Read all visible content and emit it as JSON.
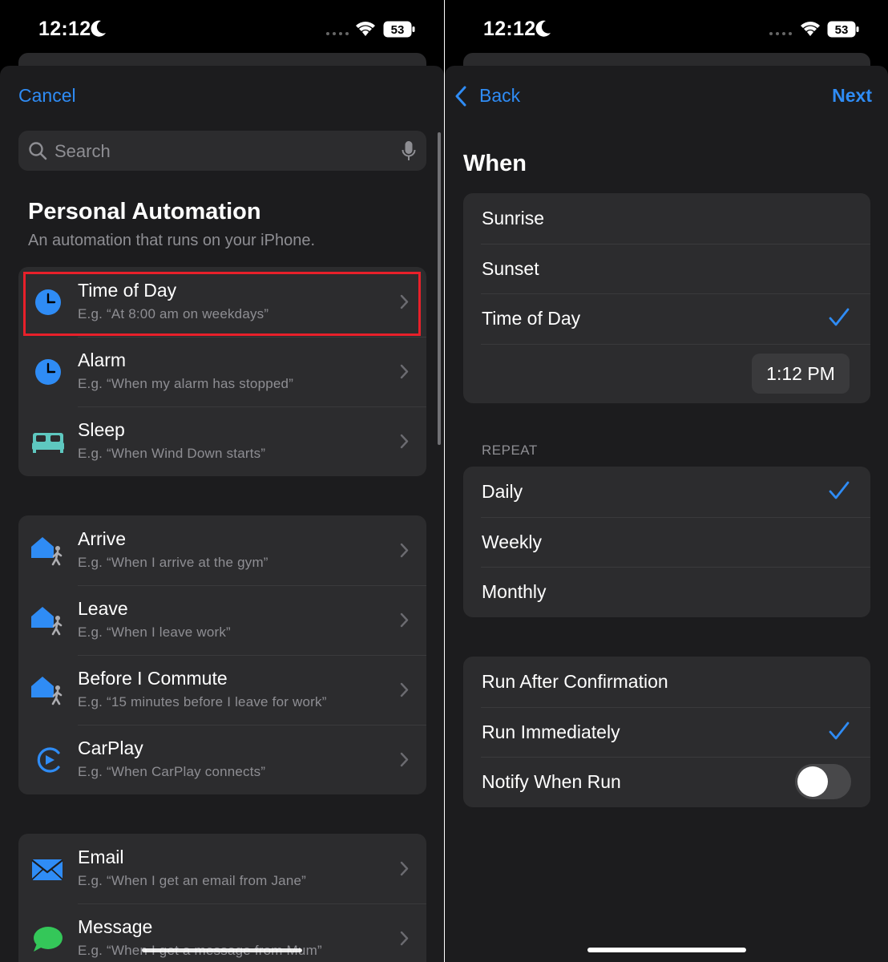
{
  "status": {
    "time": "12:12",
    "battery": "53"
  },
  "left": {
    "cancel": "Cancel",
    "search_placeholder": "Search",
    "section_title": "Personal Automation",
    "section_sub": "An automation that runs on your iPhone.",
    "groups": [
      [
        {
          "title": "Time of Day",
          "sub": "E.g. “At 8:00 am on weekdays”",
          "icon": "clock-icon"
        },
        {
          "title": "Alarm",
          "sub": "E.g. “When my alarm has stopped”",
          "icon": "alarm-clock-icon"
        },
        {
          "title": "Sleep",
          "sub": "E.g. “When Wind Down starts”",
          "icon": "bed-icon"
        }
      ],
      [
        {
          "title": "Arrive",
          "sub": "E.g. “When I arrive at the gym”",
          "icon": "home-arrive-icon"
        },
        {
          "title": "Leave",
          "sub": "E.g. “When I leave work”",
          "icon": "home-leave-icon"
        },
        {
          "title": "Before I Commute",
          "sub": "E.g. “15 minutes before I leave for work”",
          "icon": "home-commute-icon"
        },
        {
          "title": "CarPlay",
          "sub": "E.g. “When CarPlay connects”",
          "icon": "carplay-icon"
        }
      ],
      [
        {
          "title": "Email",
          "sub": "E.g. “When I get an email from Jane”",
          "icon": "envelope-icon"
        },
        {
          "title": "Message",
          "sub": "E.g. “When I get a message from Mum”",
          "icon": "message-bubble-icon"
        }
      ]
    ]
  },
  "right": {
    "back": "Back",
    "next": "Next",
    "when_title": "When",
    "when_options": [
      "Sunrise",
      "Sunset",
      "Time of Day"
    ],
    "time_value": "1:12 PM",
    "repeat_header": "REPEAT",
    "repeat_options": [
      "Daily",
      "Weekly",
      "Monthly"
    ],
    "run_options": [
      "Run After Confirmation",
      "Run Immediately"
    ],
    "notify_label": "Notify When Run",
    "notify_enabled": false
  },
  "colors": {
    "accent": "#2f8cf5",
    "highlight": "#e8202a",
    "card": "#2c2c2e",
    "sheet": "#1c1c1e"
  }
}
